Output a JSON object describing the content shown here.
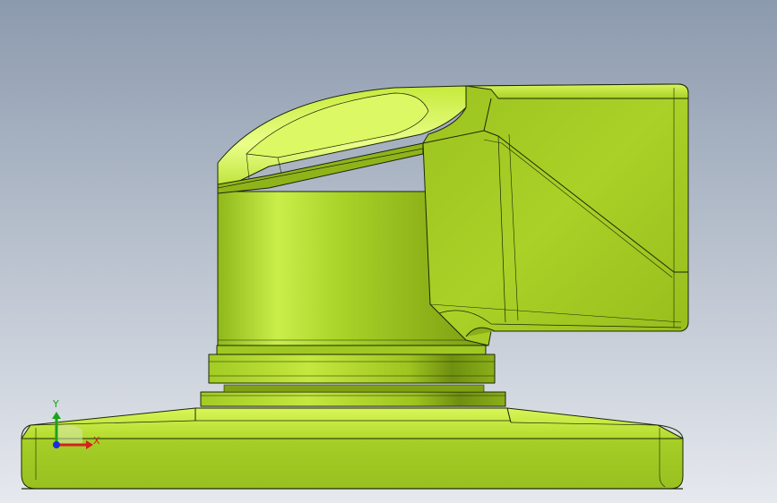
{
  "viewport": {
    "background_top": "#8c9aae",
    "background_bottom": "#e6e9ee"
  },
  "model": {
    "body_color": "#b3dc2b",
    "highlight_color": "#eaff8a",
    "shadow_color": "#6e8f10",
    "edge_color": "#1e2608"
  },
  "triad": {
    "x_label": "X",
    "y_label": "Y",
    "x_color": "#d62020",
    "y_color": "#1aa31a",
    "z_color": "#1a2fd6"
  }
}
